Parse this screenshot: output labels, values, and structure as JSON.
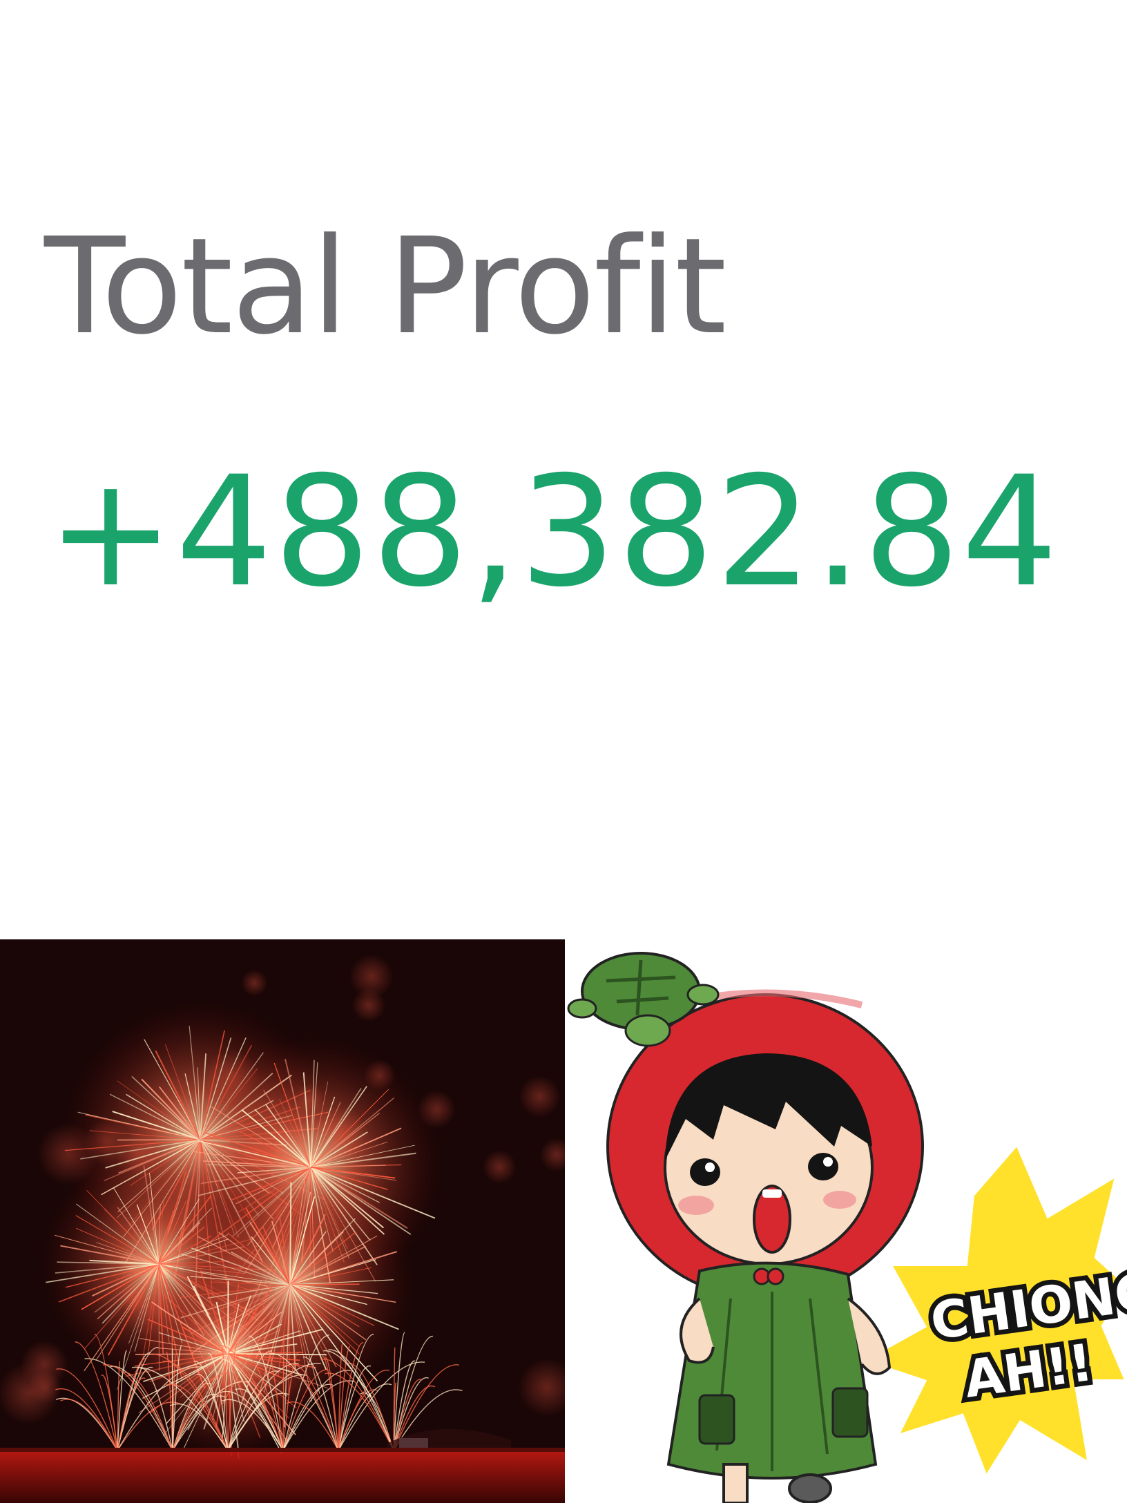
{
  "profit": {
    "label": "Total Profit",
    "value": "+488,382.84"
  },
  "sticker": {
    "caption_line1": "CHIONG",
    "caption_line2": "AH!!"
  },
  "colors": {
    "label": "#6b6b70",
    "profit_green": "#1aa36b",
    "helmet_red": "#d7282f",
    "dress_green": "#4e8a38",
    "burst_yellow": "#ffe12b"
  }
}
